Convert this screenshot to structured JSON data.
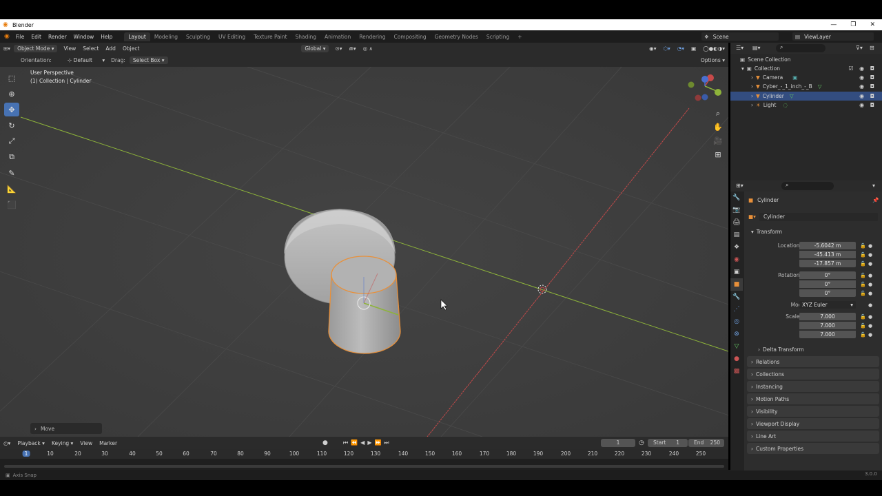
{
  "window": {
    "title": "Blender",
    "controls": [
      "—",
      "❐",
      "✕"
    ]
  },
  "menu": {
    "items": [
      "File",
      "Edit",
      "Render",
      "Window",
      "Help"
    ]
  },
  "workspaces": {
    "tabs": [
      "Layout",
      "Modeling",
      "Sculpting",
      "UV Editing",
      "Texture Paint",
      "Shading",
      "Animation",
      "Rendering",
      "Compositing",
      "Geometry Nodes",
      "Scripting"
    ],
    "active": "Layout",
    "add": "+"
  },
  "scene": {
    "name": "Scene",
    "view_layer": "ViewLayer"
  },
  "viewport_header": {
    "mode": "Object Mode",
    "menus": [
      "View",
      "Select",
      "Add",
      "Object"
    ],
    "transform_orientation": "Global"
  },
  "tool_settings": {
    "orientation_label": "Orientation:",
    "orientation_value": "Default",
    "drag_label": "Drag:",
    "drag_value": "Select Box",
    "options": "Options"
  },
  "viewport": {
    "perspective": "User Perspective",
    "collection_info": "(1) Collection | Cylinder",
    "last_op": "Move"
  },
  "timeline": {
    "menus": [
      "Playback",
      "Keying",
      "View",
      "Marker"
    ],
    "current_frame": "1",
    "start_label": "Start",
    "start": "1",
    "end_label": "End",
    "end": "250",
    "cursor_frame": "1",
    "ticks": [
      "10",
      "20",
      "30",
      "40",
      "50",
      "60",
      "70",
      "80",
      "90",
      "100",
      "110",
      "120",
      "130",
      "140",
      "150",
      "160",
      "170",
      "180",
      "190",
      "200",
      "210",
      "220",
      "230",
      "240",
      "250"
    ]
  },
  "status": {
    "hint": "Axis Snap",
    "version": "3.0.0"
  },
  "outliner": {
    "rows": [
      {
        "label": "Scene Collection"
      },
      {
        "label": "Collection"
      },
      {
        "label": "Camera"
      },
      {
        "label": "Cyber_-_1_inch_-_B"
      },
      {
        "label": "Cylinder"
      },
      {
        "label": "Light"
      }
    ]
  },
  "properties": {
    "object_name": "Cylinder",
    "data_name": "Cylinder",
    "transform_title": "Transform",
    "location": {
      "label": "Location X",
      "x": "-5.6042 m",
      "y": "-45.413 m",
      "z": "-17.857 m"
    },
    "rotation": {
      "label": "Rotation X",
      "x": "0°",
      "y": "0°",
      "z": "0°"
    },
    "mode_label": "Mode",
    "mode_value": "XYZ Euler",
    "scale": {
      "label": "Scale X",
      "x": "7.000",
      "y": "7.000",
      "z": "7.000"
    },
    "axis_y": "Y",
    "axis_z": "Z",
    "delta": "Delta Transform",
    "panels": [
      "Relations",
      "Collections",
      "Instancing",
      "Motion Paths",
      "Visibility",
      "Viewport Display",
      "Line Art",
      "Custom Properties"
    ]
  },
  "colors": {
    "accent": "#4772b3",
    "selection_outline": "#e8903a",
    "x_axis": "#c74a4a",
    "y_axis": "#8db33a"
  }
}
